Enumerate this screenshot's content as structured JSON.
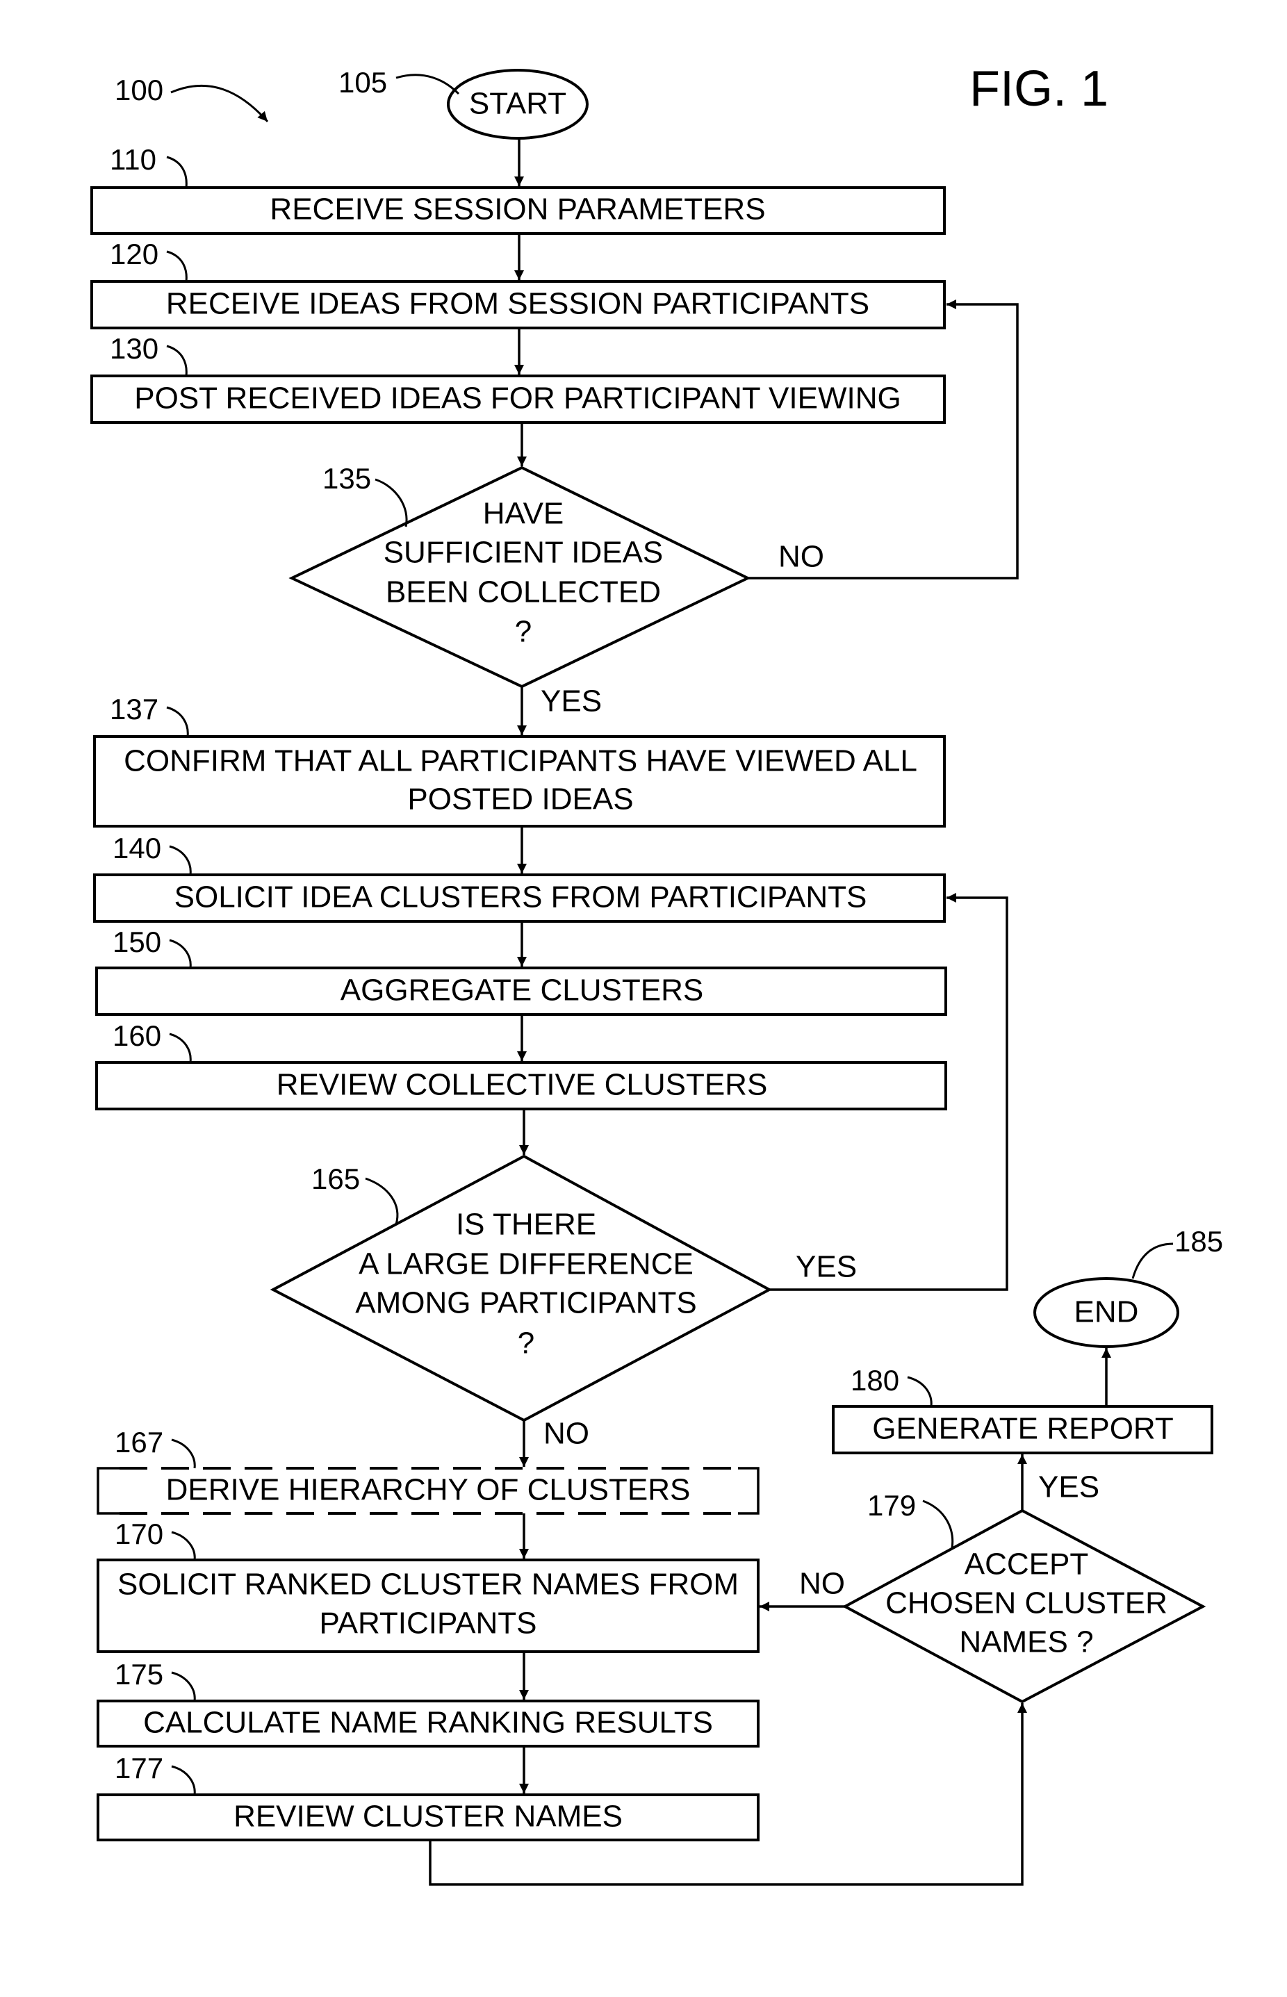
{
  "figure": {
    "title": "FIG. 1",
    "ref": "100"
  },
  "nodes": {
    "start": {
      "ref": "105",
      "label": "START"
    },
    "n110": {
      "ref": "110",
      "label": "RECEIVE SESSION PARAMETERS"
    },
    "n120": {
      "ref": "120",
      "label": "RECEIVE IDEAS FROM SESSION PARTICIPANTS"
    },
    "n130": {
      "ref": "130",
      "label": "POST RECEIVED IDEAS FOR PARTICIPANT VIEWING"
    },
    "n135": {
      "ref": "135",
      "lines": [
        "HAVE",
        "SUFFICIENT IDEAS",
        "BEEN COLLECTED",
        "?"
      ]
    },
    "n137": {
      "ref": "137",
      "lines": [
        "CONFIRM THAT ALL PARTICIPANTS HAVE VIEWED ALL",
        "POSTED IDEAS"
      ]
    },
    "n140": {
      "ref": "140",
      "label": "SOLICIT IDEA CLUSTERS FROM PARTICIPANTS"
    },
    "n150": {
      "ref": "150",
      "label": "AGGREGATE CLUSTERS"
    },
    "n160": {
      "ref": "160",
      "label": "REVIEW COLLECTIVE CLUSTERS"
    },
    "n165": {
      "ref": "165",
      "lines": [
        "IS THERE",
        "A LARGE DIFFERENCE",
        "AMONG PARTICIPANTS",
        "?"
      ]
    },
    "n167": {
      "ref": "167",
      "label": "DERIVE HIERARCHY OF CLUSTERS",
      "optional": true
    },
    "n170": {
      "ref": "170",
      "lines": [
        "SOLICIT RANKED CLUSTER NAMES FROM",
        "PARTICIPANTS"
      ]
    },
    "n175": {
      "ref": "175",
      "label": "CALCULATE NAME RANKING RESULTS"
    },
    "n177": {
      "ref": "177",
      "label": "REVIEW CLUSTER NAMES"
    },
    "n179": {
      "ref": "179",
      "lines": [
        "ACCEPT",
        "CHOSEN CLUSTER",
        "NAMES ?"
      ]
    },
    "n180": {
      "ref": "180",
      "label": "GENERATE REPORT"
    },
    "end": {
      "ref": "185",
      "label": "END"
    }
  },
  "edges": {
    "n135_no": "NO",
    "n135_yes": "YES",
    "n165_yes": "YES",
    "n165_no": "NO",
    "n179_yes": "YES",
    "n179_no": "NO"
  }
}
